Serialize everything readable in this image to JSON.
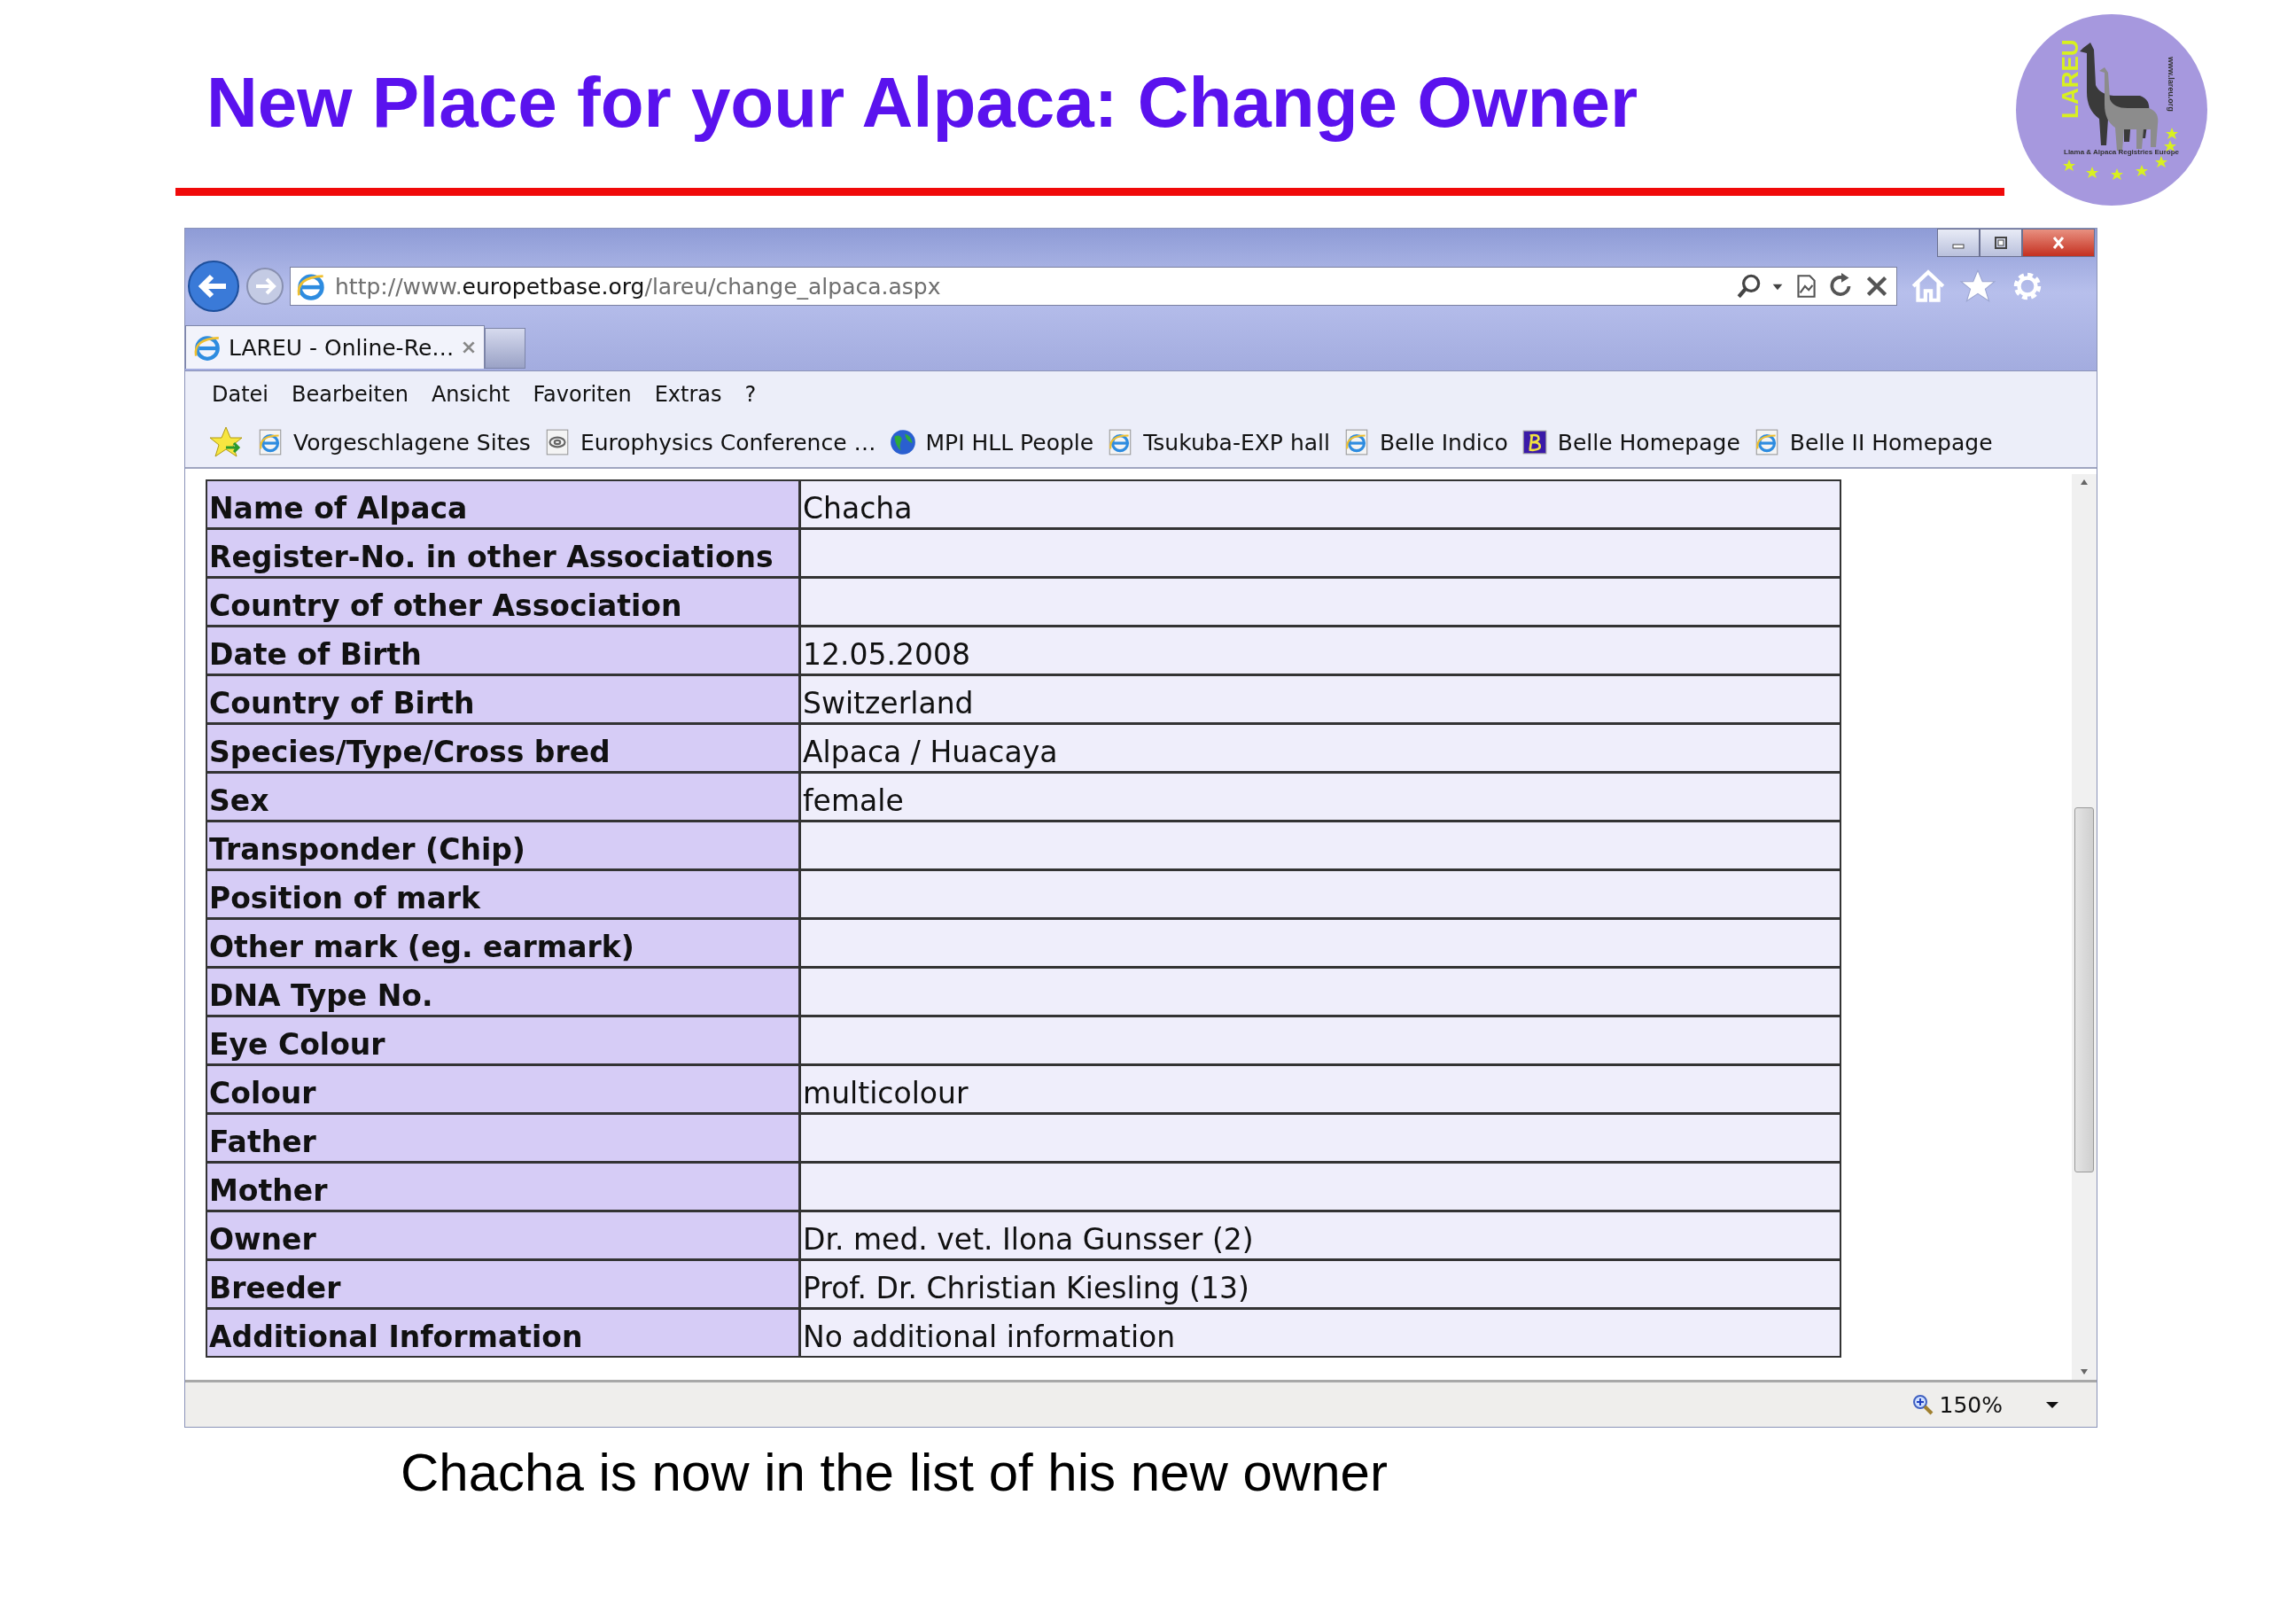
{
  "slide": {
    "title": "New Place for your Alpaca: Change Owner",
    "caption": "Chacha is now in the list of his new owner"
  },
  "logo": {
    "name": "LAREU",
    "subtitle": "Llama & Alpaca Registries Europe",
    "url": "www.lareu.org"
  },
  "browser": {
    "address": {
      "prefix": "http://www.",
      "domain": "europetbase.org",
      "path": "/lareu/change_alpaca.aspx"
    },
    "tabs": [
      {
        "label": "LAREU - Online-Re…",
        "selected": true
      }
    ],
    "menu": [
      "Datei",
      "Bearbeiten",
      "Ansicht",
      "Favoriten",
      "Extras",
      "?"
    ],
    "favorites": [
      {
        "label": "Vorgeschlagene Sites",
        "kind": "ie"
      },
      {
        "label": "Europhysics Conference …",
        "kind": "feed"
      },
      {
        "label": "MPI HLL People",
        "kind": "globe"
      },
      {
        "label": "Tsukuba-EXP hall",
        "kind": "ie"
      },
      {
        "label": "Belle Indico",
        "kind": "ie"
      },
      {
        "label": "Belle Homepage",
        "kind": "belle"
      },
      {
        "label": "Belle II Homepage",
        "kind": "ie"
      }
    ],
    "table": {
      "rows": [
        {
          "label": "Name of Alpaca",
          "value": "Chacha"
        },
        {
          "label": "Register-No. in other Associations"
        },
        {
          "label": "Country of other Association"
        },
        {
          "label": "Date of Birth",
          "value": "12.05.2008"
        },
        {
          "label": "Country of Birth",
          "value": "Switzerland"
        },
        {
          "label": "Species/Type/Cross bred",
          "value": "Alpaca / Huacaya"
        },
        {
          "label": "Sex",
          "value": "female"
        },
        {
          "label": "Transponder (Chip)"
        },
        {
          "label": "Position of mark"
        },
        {
          "label": "Other mark (eg. earmark)"
        },
        {
          "label": "DNA Type No."
        },
        {
          "label": "Eye Colour"
        },
        {
          "label": "Colour",
          "value": "multicolour"
        },
        {
          "label": "Father"
        },
        {
          "label": "Mother"
        },
        {
          "label": "Owner",
          "value": "Dr. med. vet. Ilona Gunsser (2)"
        },
        {
          "label": "Breeder",
          "value": "Prof. Dr. Christian Kiesling (13)"
        },
        {
          "label": "Additional Information",
          "value": "No additional information"
        }
      ]
    },
    "status_bar": {
      "zoom": "150%"
    }
  }
}
